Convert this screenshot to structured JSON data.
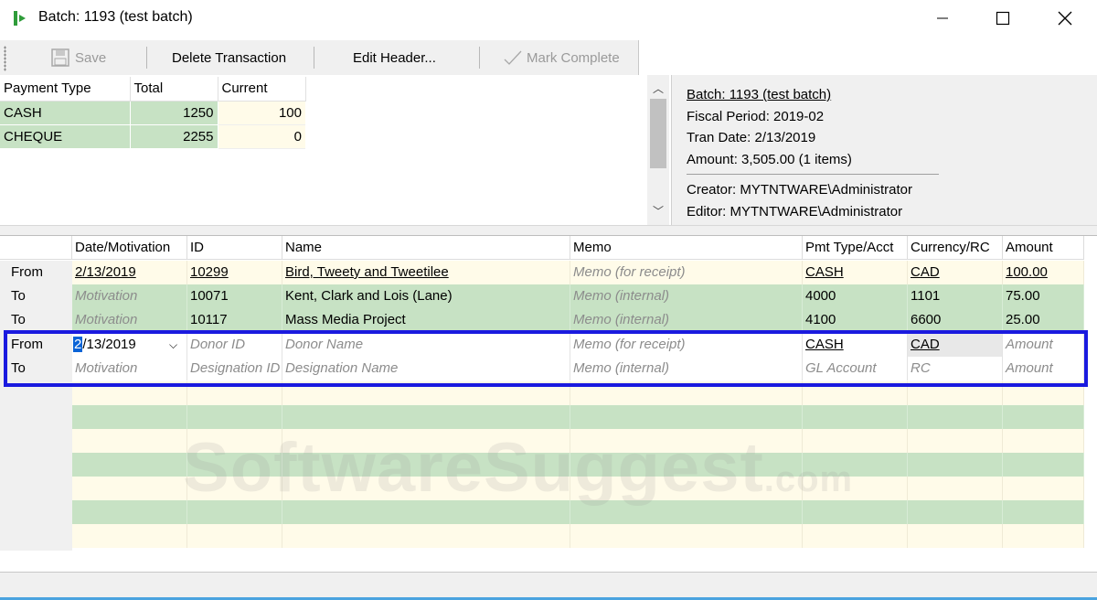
{
  "window": {
    "title": "Batch: 1193 (test batch)",
    "minimize_glyph": "—",
    "maximize_glyph": "☐",
    "close_glyph": "✕"
  },
  "toolbar": {
    "save_label": "Save",
    "delete_label": "Delete Transaction",
    "edit_header_label": "Edit Header...",
    "mark_complete_label": "Mark Complete"
  },
  "payment_types": {
    "headers": [
      "Payment Type",
      "Total",
      "Current"
    ],
    "rows": [
      {
        "type": "CASH",
        "total": "1250",
        "current": "100"
      },
      {
        "type": "CHEQUE",
        "total": "2255",
        "current": "0"
      }
    ]
  },
  "batch_info": {
    "batch": "Batch:  1193 (test batch)",
    "fiscal_period": "Fiscal Period:  2019-02",
    "tran_date": "Tran Date:  2/13/2019",
    "amount": "Amount:  3,505.00  (1 items)",
    "creator": "Creator:  MYTNTWARE\\Administrator",
    "editor": "Editor:  MYTNTWARE\\Administrator"
  },
  "grid": {
    "headers": [
      "Date/Motivation",
      "ID",
      "Name",
      "Memo",
      "Pmt Type/Acct",
      "Currency/RC",
      "Amount"
    ],
    "rows": [
      {
        "label": "From",
        "date": "2/13/2019",
        "id": "10299",
        "name": "Bird, Tweety and Tweetilee",
        "memo": "Memo (for receipt)",
        "pmt": "CASH",
        "currency": "CAD",
        "amount": "100.00"
      },
      {
        "label": "To",
        "date": "Motivation",
        "id": "10071",
        "name": "Kent, Clark and Lois (Lane)",
        "memo": "Memo (internal)",
        "pmt": "4000",
        "currency": "1101",
        "amount": "75.00"
      },
      {
        "label": "To",
        "date": "Motivation",
        "id": "10117",
        "name": "Mass Media Project",
        "memo": "Memo (internal)",
        "pmt": "4100",
        "currency": "6600",
        "amount": "25.00"
      },
      {
        "label": "From",
        "date_selected": "2",
        "date_rest": "/13/2019",
        "id": "Donor ID",
        "name": "Donor Name",
        "memo": "Memo (for receipt)",
        "pmt": "CASH",
        "currency": "CAD",
        "amount": "Amount"
      },
      {
        "label": "To",
        "date": "Motivation",
        "id": "Designation ID",
        "name": "Designation Name",
        "memo": "Memo (internal)",
        "pmt": "GL Account",
        "currency": "RC",
        "amount": "Amount"
      }
    ]
  },
  "watermark": {
    "main": "SoftwareSuggest",
    "suffix": ".com"
  }
}
